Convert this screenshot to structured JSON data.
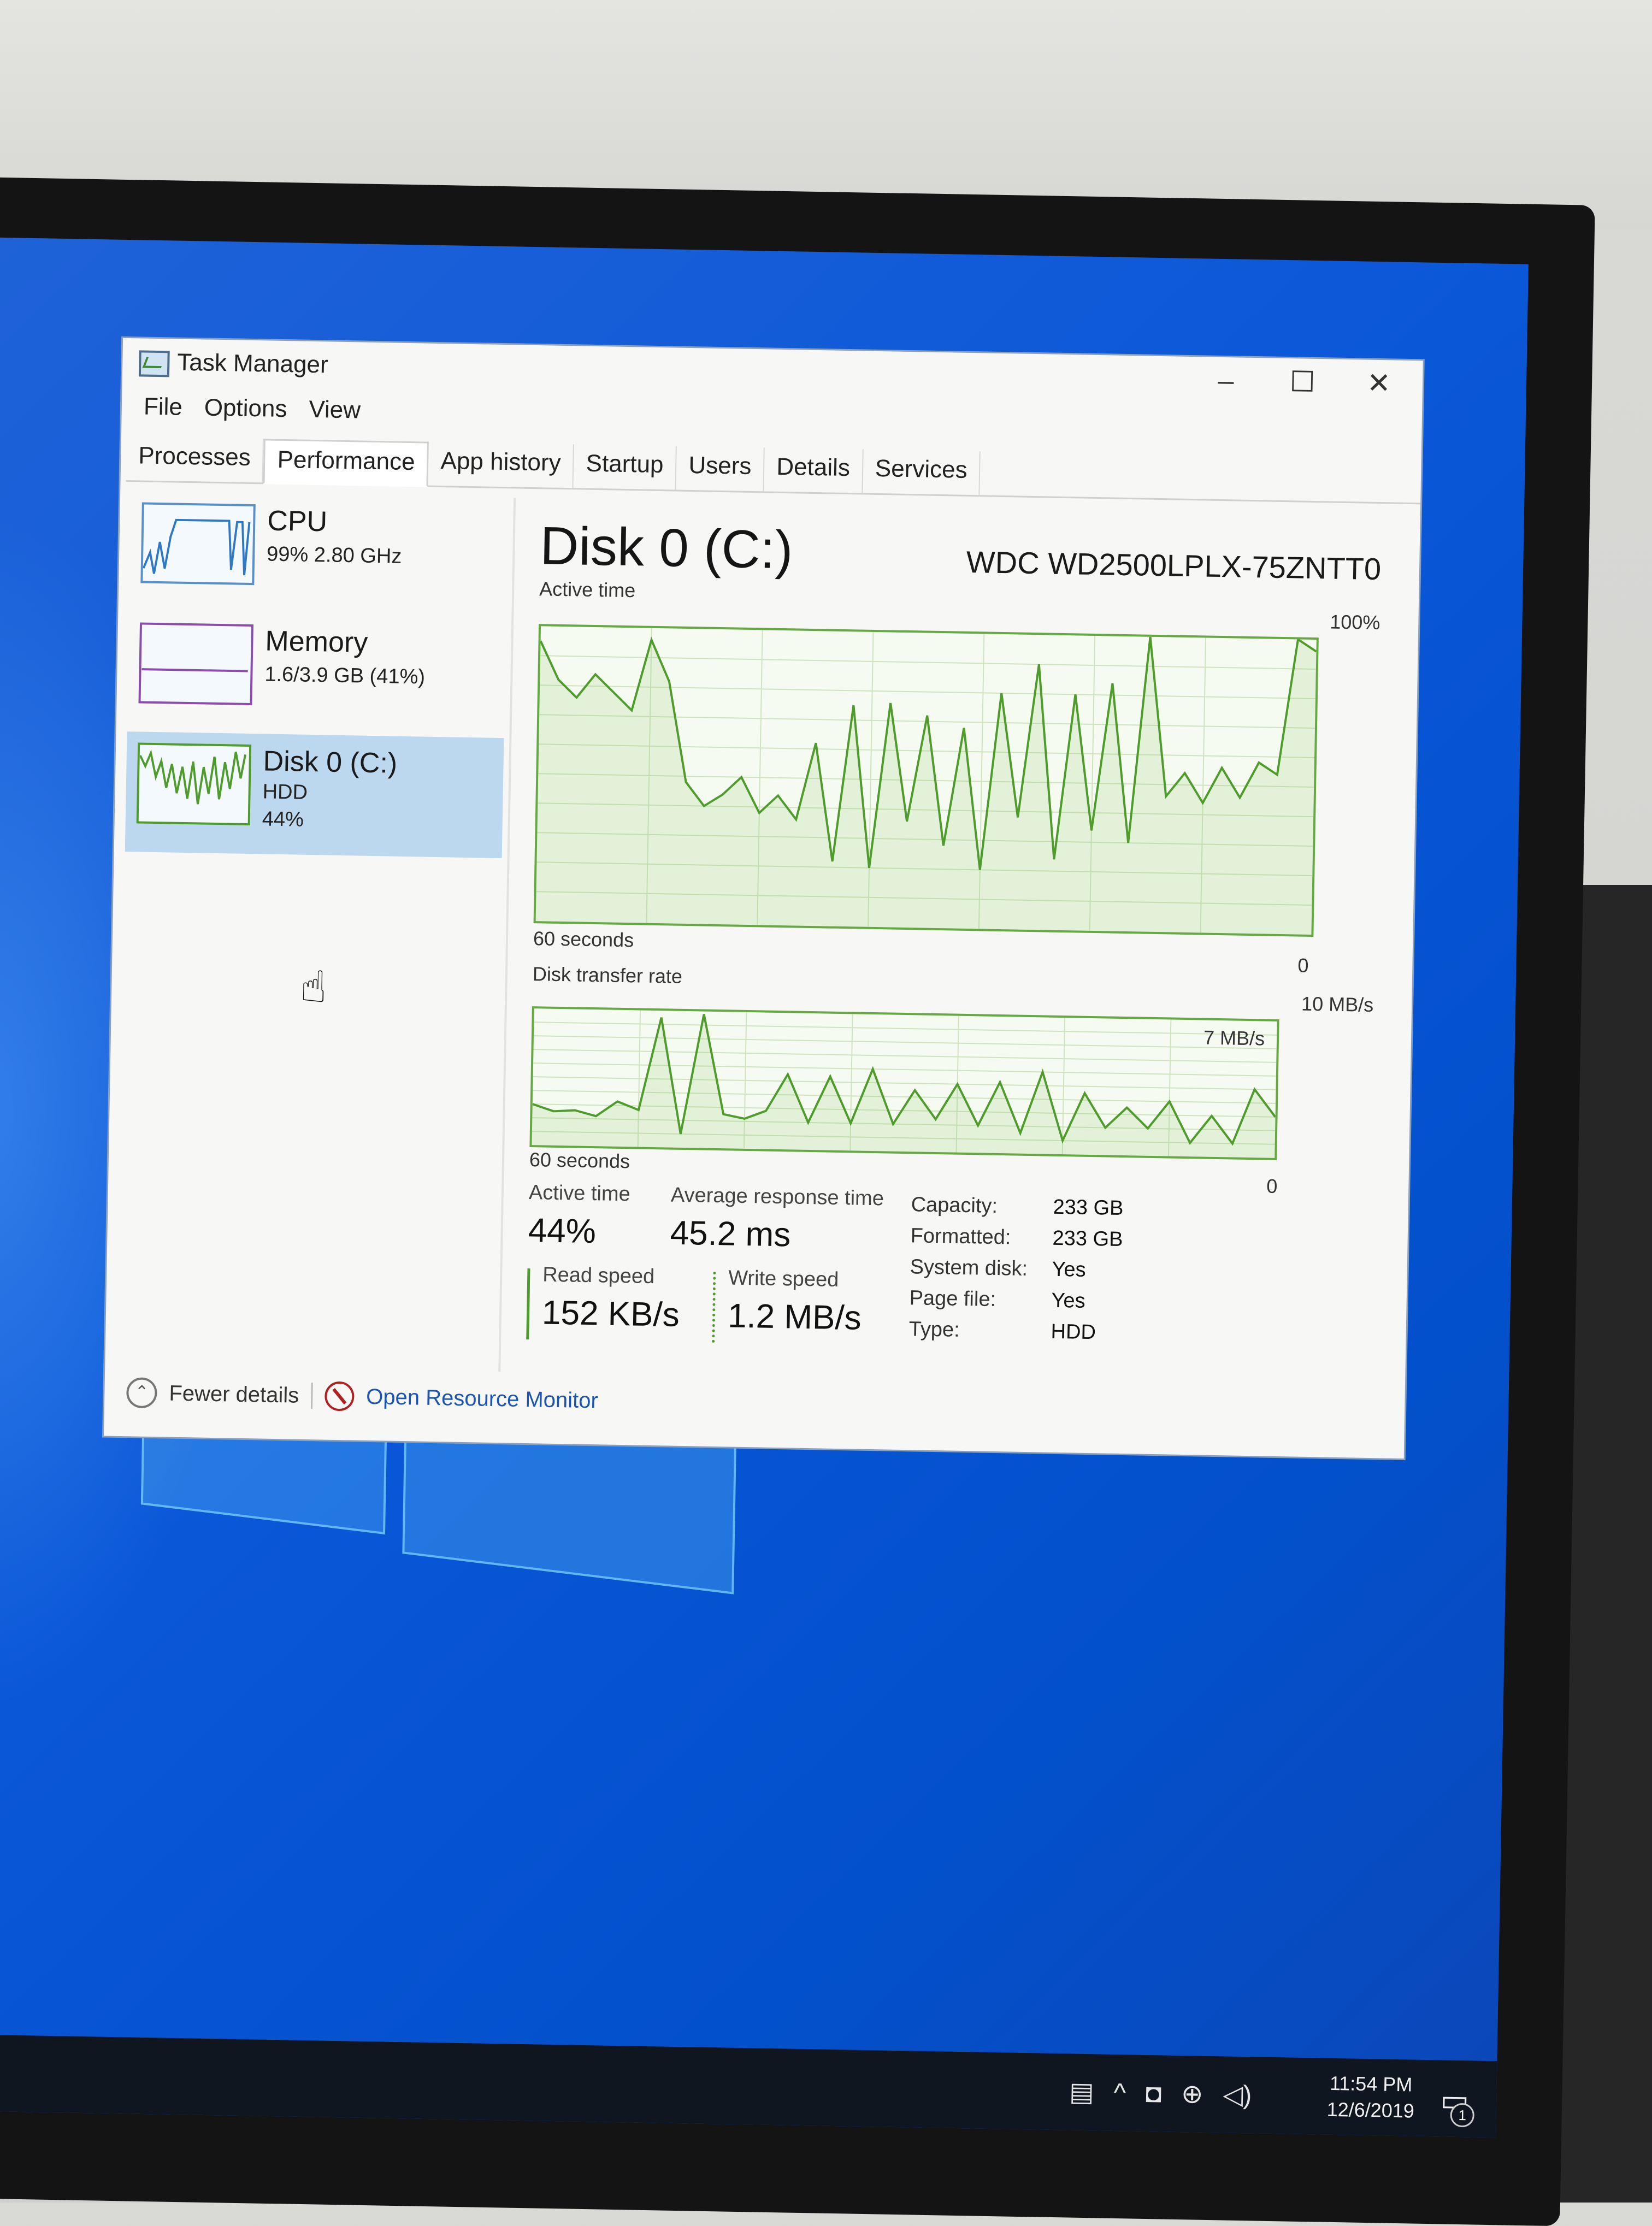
{
  "window": {
    "title": "Task Manager",
    "controls": {
      "minimize": "–",
      "maximize": "☐",
      "close": "✕"
    }
  },
  "menu": [
    "File",
    "Options",
    "View"
  ],
  "tabs": [
    "Processes",
    "Performance",
    "App history",
    "Startup",
    "Users",
    "Details",
    "Services"
  ],
  "active_tab": "Performance",
  "sidebar": {
    "cpu": {
      "name": "CPU",
      "detail": "99% 2.80 GHz"
    },
    "memory": {
      "name": "Memory",
      "detail": "1.6/3.9 GB (41%)"
    },
    "disk": {
      "name": "Disk 0 (C:)",
      "type": "HDD",
      "detail": "44%"
    }
  },
  "main": {
    "title": "Disk 0 (C:)",
    "model": "WDC WD2500LPLX-75ZNTT0",
    "active_time_graph": {
      "label": "Active time",
      "max": "100%",
      "span": "60 seconds",
      "min": "0"
    },
    "transfer_graph": {
      "label": "Disk transfer rate",
      "max": "10 MB/s",
      "line": "7 MB/s",
      "span": "60 seconds",
      "min": "0"
    },
    "stats": {
      "active_time_label": "Active time",
      "active_time": "44%",
      "avg_response_label": "Average response time",
      "avg_response": "45.2 ms",
      "read_speed_label": "Read speed",
      "read_speed": "152 KB/s",
      "write_speed_label": "Write speed",
      "write_speed": "1.2 MB/s"
    },
    "properties": [
      {
        "key": "Capacity:",
        "value": "233 GB"
      },
      {
        "key": "Formatted:",
        "value": "233 GB"
      },
      {
        "key": "System disk:",
        "value": "Yes"
      },
      {
        "key": "Page file:",
        "value": "Yes"
      },
      {
        "key": "Type:",
        "value": "HDD"
      }
    ]
  },
  "chart_data": [
    {
      "type": "line",
      "ylabel": "Active time",
      "ylim": [
        0,
        100
      ],
      "values": [
        95,
        82,
        76,
        84,
        78,
        72,
        96,
        82,
        48,
        40,
        44,
        50,
        38,
        44,
        36,
        62,
        22,
        75,
        20,
        76,
        36,
        72,
        28,
        68,
        20,
        80,
        38,
        90,
        24,
        80,
        34,
        84,
        30,
        100,
        46,
        54,
        44,
        56,
        46,
        58,
        54,
        100,
        96
      ]
    },
    {
      "type": "line",
      "ylabel": "Disk transfer rate",
      "ylim": [
        0,
        10
      ],
      "values": [
        3,
        2.5,
        2.6,
        2.2,
        3.3,
        2.7,
        9.5,
        1.0,
        9.8,
        2.5,
        2.2,
        2.8,
        5.5,
        2.0,
        5.4,
        2.0,
        6.0,
        2.0,
        4.5,
        2.4,
        5.0,
        2.0,
        5.2,
        1.5,
        6.0,
        1.0,
        4.5,
        2.0,
        3.5,
        2.0,
        4.0,
        1.0,
        3.0,
        1.0,
        5.0,
        3.0
      ]
    }
  ],
  "footer": {
    "fewer_details": "Fewer details",
    "resource_monitor": "Open Resource Monitor"
  },
  "taskbar": {
    "time": "11:54 PM",
    "date": "12/6/2019",
    "notification_count": "1"
  }
}
